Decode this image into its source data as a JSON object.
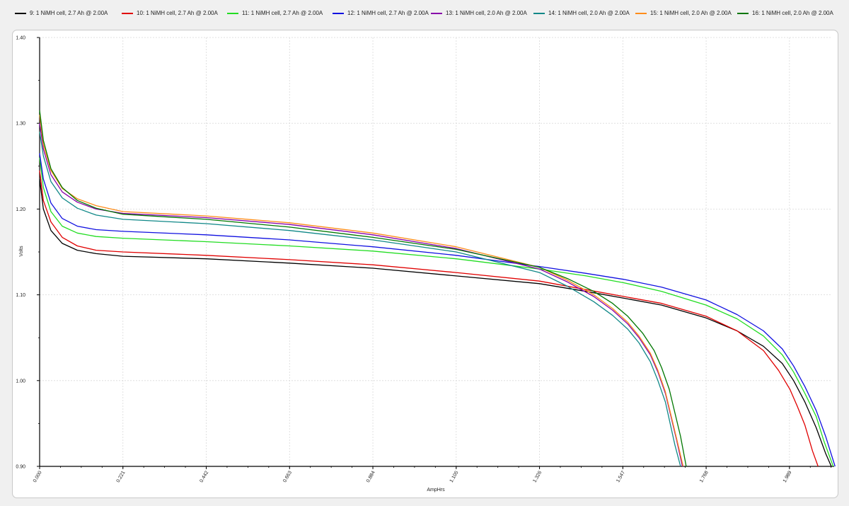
{
  "chart_data": {
    "type": "line",
    "xlabel": "AmpHrs",
    "ylabel": "Volts",
    "xlim": [
      0.0,
      2.1
    ],
    "ylim": [
      0.9,
      1.4
    ],
    "grid": true,
    "legend_position": "top",
    "x_ticks": [
      "0.000",
      "0.221",
      "0.442",
      "0.663",
      "0.884",
      "1.105",
      "1.326",
      "1.547",
      "1.768",
      "1.989"
    ],
    "y_ticks": [
      "0.90",
      "1.00",
      "1.10",
      "1.20",
      "1.30",
      "1.40"
    ],
    "series": [
      {
        "name": "9: 1 NiMH cell, 2.7 Ah @ 2.00A",
        "color": "#000000",
        "x": [
          0,
          0.01,
          0.03,
          0.06,
          0.1,
          0.15,
          0.221,
          0.442,
          0.663,
          0.884,
          1.105,
          1.326,
          1.45,
          1.55,
          1.65,
          1.768,
          1.85,
          1.92,
          1.97,
          2.0,
          2.03,
          2.06,
          2.085,
          2.1
        ],
        "y": [
          1.235,
          1.2,
          1.175,
          1.16,
          1.152,
          1.148,
          1.145,
          1.142,
          1.137,
          1.131,
          1.122,
          1.113,
          1.104,
          1.096,
          1.088,
          1.073,
          1.058,
          1.04,
          1.02,
          1.0,
          0.975,
          0.945,
          0.915,
          0.9
        ]
      },
      {
        "name": "10: 1 NiMH cell, 2.7 Ah @ 2.00A",
        "color": "#e00000",
        "x": [
          0,
          0.01,
          0.03,
          0.06,
          0.1,
          0.15,
          0.221,
          0.442,
          0.663,
          0.884,
          1.105,
          1.326,
          1.45,
          1.55,
          1.65,
          1.768,
          1.85,
          1.92,
          1.96,
          1.99,
          2.01,
          2.03,
          2.05,
          2.065
        ],
        "y": [
          1.245,
          1.21,
          1.185,
          1.167,
          1.157,
          1.152,
          1.15,
          1.146,
          1.141,
          1.135,
          1.126,
          1.116,
          1.106,
          1.098,
          1.09,
          1.075,
          1.058,
          1.035,
          1.012,
          0.99,
          0.97,
          0.948,
          0.918,
          0.9
        ]
      },
      {
        "name": "11: 1 NiMH cell, 2.7 Ah @ 2.00A",
        "color": "#22dd22",
        "x": [
          0,
          0.01,
          0.03,
          0.06,
          0.1,
          0.15,
          0.221,
          0.442,
          0.663,
          0.884,
          1.105,
          1.326,
          1.45,
          1.55,
          1.65,
          1.768,
          1.85,
          1.92,
          1.97,
          2.0,
          2.03,
          2.06,
          2.08,
          2.105
        ],
        "y": [
          1.26,
          1.225,
          1.197,
          1.18,
          1.172,
          1.168,
          1.166,
          1.162,
          1.157,
          1.151,
          1.142,
          1.13,
          1.122,
          1.114,
          1.104,
          1.088,
          1.072,
          1.052,
          1.03,
          1.01,
          0.985,
          0.958,
          0.93,
          0.9
        ]
      },
      {
        "name": "12: 1 NiMH cell, 2.7 Ah @ 2.00A",
        "color": "#1010e0",
        "x": [
          0,
          0.01,
          0.03,
          0.06,
          0.1,
          0.15,
          0.221,
          0.442,
          0.663,
          0.884,
          1.105,
          1.326,
          1.45,
          1.55,
          1.65,
          1.768,
          1.85,
          1.92,
          1.97,
          2.0,
          2.03,
          2.06,
          2.085,
          2.11
        ],
        "y": [
          1.265,
          1.235,
          1.207,
          1.189,
          1.18,
          1.176,
          1.174,
          1.17,
          1.164,
          1.156,
          1.146,
          1.133,
          1.125,
          1.118,
          1.109,
          1.094,
          1.077,
          1.058,
          1.037,
          1.017,
          0.993,
          0.965,
          0.935,
          0.9
        ]
      },
      {
        "name": "13: 1 NiMH cell, 2.0 Ah @ 2.00A",
        "color": "#8800aa",
        "x": [
          0,
          0.01,
          0.03,
          0.06,
          0.1,
          0.15,
          0.221,
          0.442,
          0.663,
          0.884,
          1.105,
          1.326,
          1.4,
          1.47,
          1.52,
          1.56,
          1.59,
          1.62,
          1.64,
          1.66,
          1.69,
          1.705
        ],
        "y": [
          1.3,
          1.27,
          1.24,
          1.22,
          1.208,
          1.2,
          1.195,
          1.19,
          1.182,
          1.17,
          1.154,
          1.13,
          1.115,
          1.098,
          1.082,
          1.066,
          1.05,
          1.03,
          1.01,
          0.985,
          0.93,
          0.9
        ]
      },
      {
        "name": "14: 1 NiMH cell, 2.0 Ah @ 2.00A",
        "color": "#108888",
        "x": [
          0,
          0.01,
          0.03,
          0.06,
          0.1,
          0.15,
          0.221,
          0.442,
          0.663,
          0.884,
          1.105,
          1.326,
          1.4,
          1.47,
          1.52,
          1.56,
          1.59,
          1.62,
          1.64,
          1.66,
          1.685,
          1.7
        ],
        "y": [
          1.29,
          1.262,
          1.232,
          1.213,
          1.201,
          1.193,
          1.188,
          1.183,
          1.175,
          1.164,
          1.15,
          1.126,
          1.11,
          1.092,
          1.076,
          1.06,
          1.044,
          1.022,
          1.0,
          0.975,
          0.925,
          0.9
        ]
      },
      {
        "name": "15: 1 NiMH cell, 2.0 Ah @ 2.00A",
        "color": "#ff8c1a",
        "x": [
          0,
          0.01,
          0.03,
          0.06,
          0.1,
          0.15,
          0.221,
          0.442,
          0.663,
          0.884,
          1.105,
          1.326,
          1.4,
          1.47,
          1.52,
          1.56,
          1.59,
          1.62,
          1.64,
          1.66,
          1.69,
          1.707
        ],
        "y": [
          1.31,
          1.275,
          1.245,
          1.224,
          1.212,
          1.204,
          1.197,
          1.192,
          1.184,
          1.172,
          1.156,
          1.132,
          1.117,
          1.1,
          1.084,
          1.068,
          1.052,
          1.032,
          1.012,
          0.987,
          0.932,
          0.9
        ]
      },
      {
        "name": "16: 1 NiMH cell, 2.0 Ah @ 2.00A",
        "color": "#007700",
        "x": [
          0,
          0.01,
          0.03,
          0.06,
          0.1,
          0.15,
          0.221,
          0.442,
          0.663,
          0.884,
          1.105,
          1.326,
          1.4,
          1.47,
          1.52,
          1.56,
          1.6,
          1.63,
          1.65,
          1.67,
          1.7,
          1.715
        ],
        "y": [
          1.315,
          1.28,
          1.247,
          1.225,
          1.21,
          1.201,
          1.194,
          1.188,
          1.179,
          1.167,
          1.153,
          1.132,
          1.119,
          1.104,
          1.09,
          1.075,
          1.055,
          1.035,
          1.015,
          0.99,
          0.935,
          0.9
        ]
      }
    ]
  }
}
